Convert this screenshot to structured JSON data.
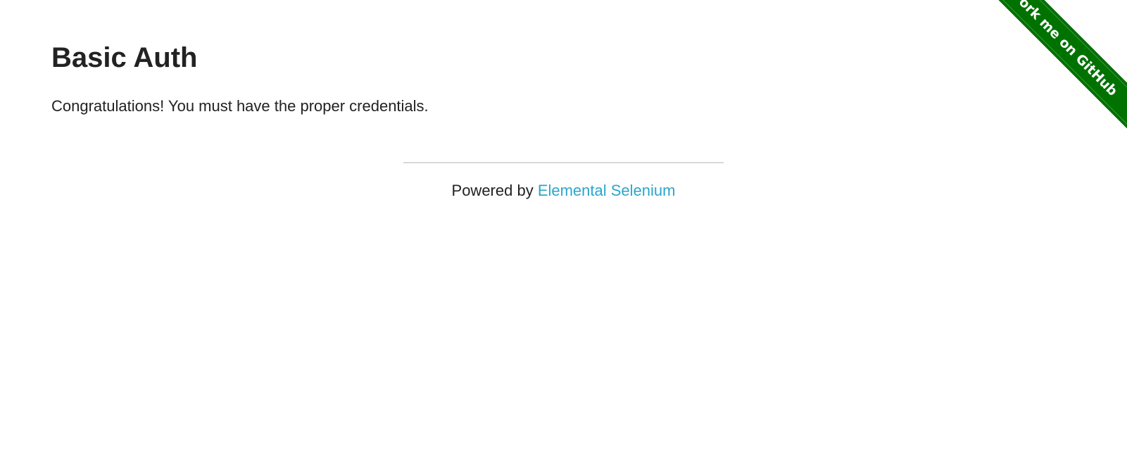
{
  "page": {
    "title": "Basic Auth",
    "message": "Congratulations! You must have the proper credentials."
  },
  "footer": {
    "prefix": "Powered by ",
    "link_label": "Elemental Selenium",
    "link_color": "#2ba6cb"
  },
  "ribbon": {
    "label": "Fork me on GitHub",
    "color": "#007200"
  }
}
